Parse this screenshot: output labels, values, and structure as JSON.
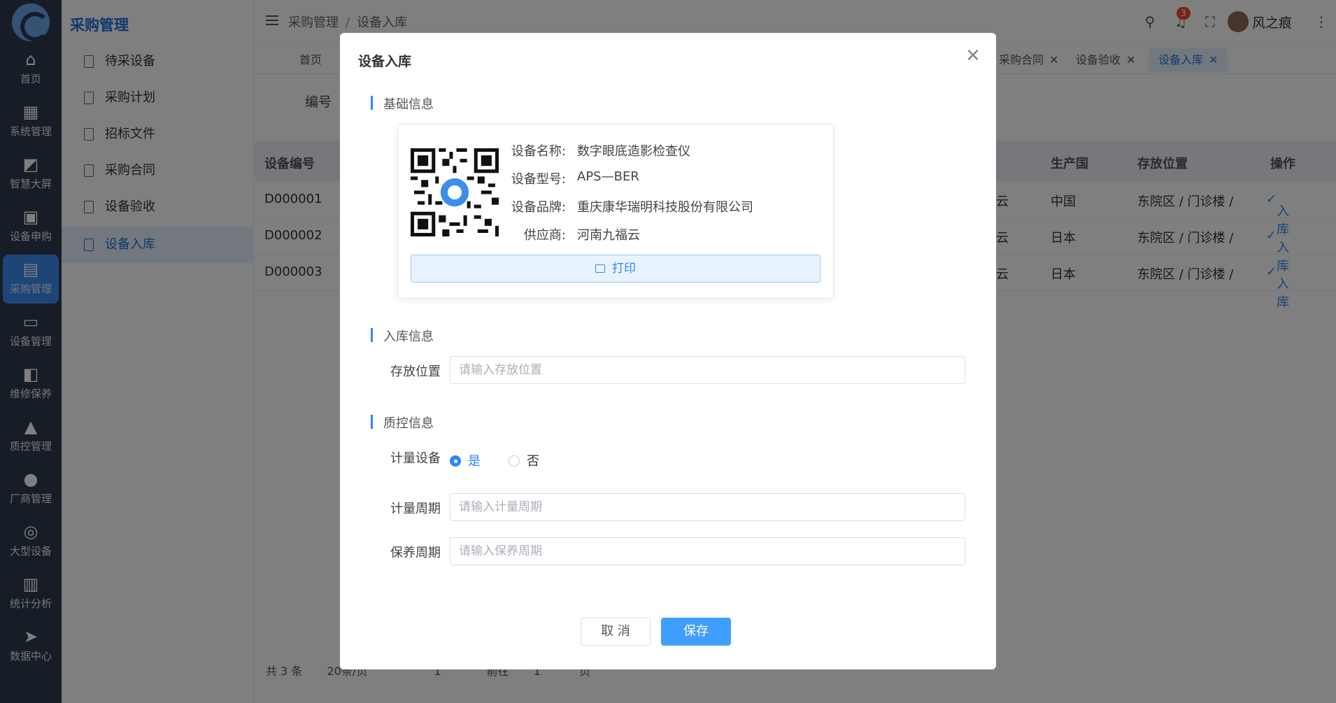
{
  "rail": {
    "items": [
      {
        "label": "首页",
        "icon": "home-icon"
      },
      {
        "label": "系统管理",
        "icon": "grid-icon"
      },
      {
        "label": "智慧大屏",
        "icon": "chart-icon"
      },
      {
        "label": "设备申购",
        "icon": "clipboard-icon"
      },
      {
        "label": "采购管理",
        "icon": "briefcase-icon",
        "active": true
      },
      {
        "label": "设备管理",
        "icon": "monitor-icon"
      },
      {
        "label": "维修保养",
        "icon": "wallet-icon"
      },
      {
        "label": "质控管理",
        "icon": "stamp-icon"
      },
      {
        "label": "厂商管理",
        "icon": "user-icon"
      },
      {
        "label": "大型设备",
        "icon": "chrome-icon"
      },
      {
        "label": "统计分析",
        "icon": "bar-chart-icon"
      },
      {
        "label": "数据中心",
        "icon": "send-icon"
      }
    ]
  },
  "submenu": {
    "title": "采购管理",
    "items": [
      {
        "label": "待采设备"
      },
      {
        "label": "采购计划"
      },
      {
        "label": "招标文件"
      },
      {
        "label": "采购合同"
      },
      {
        "label": "设备验收"
      },
      {
        "label": "设备入库",
        "active": true
      }
    ]
  },
  "header": {
    "breadcrumb": [
      "采购管理",
      "设备入库"
    ],
    "notification_count": "3",
    "username": "风之痕"
  },
  "tabs": [
    {
      "label": "首页"
    },
    {
      "label": "采购合同"
    },
    {
      "label": "设备验收"
    },
    {
      "label": "设备入库",
      "active": true
    }
  ],
  "page": {
    "query_label": "编号",
    "table_headers": [
      "设备编号",
      "生产国",
      "存放位置",
      "操作"
    ],
    "rows": [
      {
        "id": "D000001",
        "supplier_tail": "云",
        "country": "中国",
        "location": "东院区 / 门诊楼 /",
        "action": "入库"
      },
      {
        "id": "D000002",
        "supplier_tail": "云",
        "country": "日本",
        "location": "东院区 / 门诊楼 /",
        "action": "入库"
      },
      {
        "id": "D000003",
        "supplier_tail": "云",
        "country": "日本",
        "location": "东院区 / 门诊楼 /",
        "action": "入库"
      }
    ],
    "pager": {
      "total": "共 3 条",
      "page_size": "20条/页",
      "current": "1",
      "goto_label": "前往",
      "goto_value": "1",
      "page_suffix": "页"
    }
  },
  "dialog": {
    "title": "设备入库",
    "section_basic": "基础信息",
    "device": {
      "name_label": "设备名称:",
      "name": "数字眼底造影检查仪",
      "model_label": "设备型号:",
      "model": "APS—BER",
      "brand_label": "设备品牌:",
      "brand": "重庆康华瑞明科技股份有限公司",
      "supplier_label": "供应商:",
      "supplier": "河南九福云"
    },
    "print_label": "打印",
    "section_storage": "入库信息",
    "location_label": "存放位置",
    "location_placeholder": "请输入存放位置",
    "section_qc": "质控信息",
    "metering_label": "计量设备",
    "metering_yes": "是",
    "metering_no": "否",
    "metering_selected": "是",
    "cycle_label": "计量周期",
    "cycle_placeholder": "请输入计量周期",
    "maintain_label": "保养周期",
    "maintain_placeholder": "请输入保养周期",
    "cancel_label": "取 消",
    "save_label": "保存"
  },
  "colors": {
    "primary": "#409eff",
    "rail_bg": "#2e3a4c",
    "active_rail": "#3d8bf0",
    "accent_text": "#1e70d6"
  }
}
